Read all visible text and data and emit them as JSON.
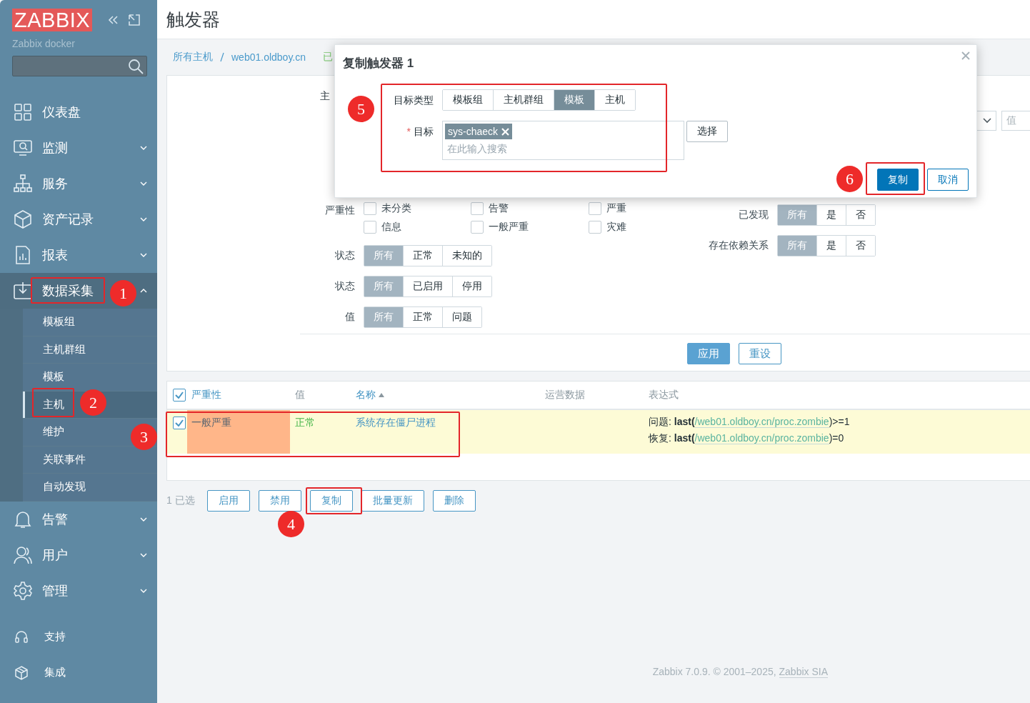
{
  "sidebar": {
    "logo": "ZABBIX",
    "server_name": "Zabbix docker",
    "menu": [
      {
        "label": "仪表盘"
      },
      {
        "label": "监测",
        "expanded": false
      },
      {
        "label": "服务",
        "expanded": false
      },
      {
        "label": "资产记录",
        "expanded": false
      },
      {
        "label": "报表",
        "expanded": false
      },
      {
        "label": "数据采集",
        "expanded": true,
        "children": [
          {
            "label": "模板组",
            "selected": false
          },
          {
            "label": "主机群组",
            "selected": false
          },
          {
            "label": "模板",
            "selected": false
          },
          {
            "label": "主机",
            "selected": true
          },
          {
            "label": "维护",
            "selected": false
          },
          {
            "label": "关联事件",
            "selected": false
          },
          {
            "label": "自动发现",
            "selected": false
          }
        ]
      },
      {
        "label": "告警",
        "expanded": false
      },
      {
        "label": "用户",
        "expanded": false
      },
      {
        "label": "管理",
        "expanded": false
      }
    ],
    "bottom_menu": [
      {
        "label": "支持"
      },
      {
        "label": "集成"
      }
    ]
  },
  "page": {
    "title": "触发器",
    "breadcrumbs": [
      "所有主机",
      "web01.oldboy.cn",
      "已"
    ]
  },
  "filter": {
    "host_label": "主",
    "value_placeholder": "值",
    "severity_label": "严重性",
    "severities": [
      {
        "label": "未分类",
        "checked": false
      },
      {
        "label": "告警",
        "checked": false
      },
      {
        "label": "严重",
        "checked": false
      },
      {
        "label": "信息",
        "checked": false
      },
      {
        "label": "一般严重",
        "checked": false
      },
      {
        "label": "灾难",
        "checked": false
      }
    ],
    "segments": [
      {
        "label": "状态",
        "options": [
          {
            "label": "所有",
            "selected": true
          },
          {
            "label": "正常",
            "selected": false
          },
          {
            "label": "未知的",
            "selected": false
          }
        ]
      },
      {
        "label": "状态",
        "options": [
          {
            "label": "所有",
            "selected": true
          },
          {
            "label": "已启用",
            "selected": false
          },
          {
            "label": "停用",
            "selected": false
          }
        ]
      },
      {
        "label": "值",
        "options": [
          {
            "label": "所有",
            "selected": true
          },
          {
            "label": "正常",
            "selected": false
          },
          {
            "label": "问题",
            "selected": false
          }
        ]
      }
    ],
    "right_segments": [
      {
        "label": "已发现",
        "options": [
          {
            "label": "所有",
            "selected": true
          },
          {
            "label": "是",
            "selected": false
          },
          {
            "label": "否",
            "selected": false
          }
        ]
      },
      {
        "label": "存在依赖关系",
        "options": [
          {
            "label": "所有",
            "selected": true
          },
          {
            "label": "是",
            "selected": false
          },
          {
            "label": "否",
            "selected": false
          }
        ]
      }
    ],
    "buttons": [
      {
        "label": "应用",
        "kind": "primary"
      },
      {
        "label": "重设",
        "kind": "secondary"
      }
    ]
  },
  "table": {
    "header_checked": true,
    "columns": [
      {
        "label": "严重性",
        "sortable": true
      },
      {
        "label": "值",
        "sortable": false
      },
      {
        "label": "名称",
        "sortable": true,
        "sorted_ascending": true
      },
      {
        "label": "运营数据",
        "sortable": false
      },
      {
        "label": "表达式",
        "sortable": false
      }
    ],
    "rows": [
      {
        "selected": true,
        "severity": "一般严重",
        "color": "#ffb689",
        "value": "正常",
        "name": "系统存在僵尸进程",
        "expression": [
          {
            "prefix": "问题: ",
            "function": "last(",
            "item": "/web01.oldboy.cn/proc.zombie",
            "suffix": ")>=1"
          },
          {
            "prefix": "恢复: ",
            "function": "last(",
            "item": "/web01.oldboy.cn/proc.zombie",
            "suffix": ")=0"
          }
        ]
      }
    ]
  },
  "actions": {
    "selected_count": "1 已选",
    "buttons": [
      "启用",
      "禁用",
      "复制",
      "批量更新",
      "删除"
    ]
  },
  "footer": {
    "text": "Zabbix 7.0.9. © 2001–2025, ",
    "link": "Zabbix SIA"
  },
  "dialog": {
    "title": "复制触发器 1",
    "target_type_label": "目标类型",
    "target_types": [
      {
        "label": "模板组",
        "selected": false
      },
      {
        "label": "主机群组",
        "selected": false
      },
      {
        "label": "模板",
        "selected": true
      },
      {
        "label": "主机",
        "selected": false
      }
    ],
    "required_mark": "*",
    "target_label": "目标",
    "chips": [
      "sys-chaeck"
    ],
    "search_placeholder": "在此输入搜索",
    "select_button": "选择",
    "buttons": [
      {
        "label": "复制",
        "kind": "primary"
      },
      {
        "label": "取消",
        "kind": "secondary"
      }
    ]
  },
  "annotations": [
    {
      "label": "1"
    },
    {
      "label": "2"
    },
    {
      "label": "3"
    },
    {
      "label": "4"
    },
    {
      "label": "5"
    },
    {
      "label": "6"
    }
  ]
}
